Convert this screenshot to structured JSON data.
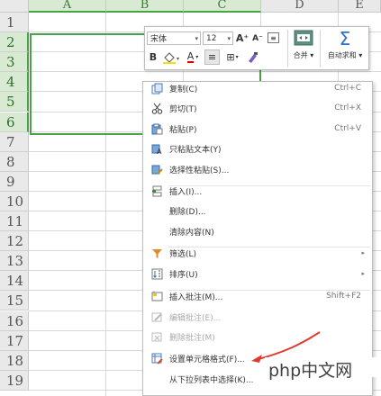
{
  "columns": [
    {
      "label": "A",
      "selected": true
    },
    {
      "label": "B",
      "selected": true
    },
    {
      "label": "C",
      "selected": true
    },
    {
      "label": "D",
      "selected": false
    },
    {
      "label": "E",
      "selected": false
    }
  ],
  "rows": [
    "1",
    "2",
    "3",
    "4",
    "5",
    "6",
    "7",
    "8",
    "9",
    "10",
    "11",
    "12",
    "13",
    "14",
    "15",
    "16",
    "17",
    "18",
    "19"
  ],
  "selected_rows": [
    "2",
    "3",
    "4",
    "5",
    "6"
  ],
  "colors": {
    "selection": "#4aa14a",
    "header_selected": "#d9ead3",
    "arrow": "#e03a2f"
  },
  "toolbar": {
    "font_name": "宋体",
    "font_size": "12",
    "grow_font_icon": "A⁺",
    "shrink_font_icon": "A⁻",
    "bold": "B",
    "underline_color_icon": "A",
    "merge_label": "合并",
    "autosum_label": "自动求和",
    "autosum_icon": "Σ"
  },
  "menu": {
    "items": [
      {
        "icon": "copy-icon",
        "label": "复制(C)",
        "shortcut": "Ctrl+C",
        "disabled": false
      },
      {
        "icon": "scissors-icon",
        "label": "剪切(T)",
        "shortcut": "Ctrl+X",
        "disabled": false
      },
      {
        "icon": "paste-icon",
        "label": "粘贴(P)",
        "shortcut": "Ctrl+V",
        "disabled": false
      },
      {
        "icon": "paste-text-icon",
        "label": "只粘贴文本(Y)",
        "shortcut": "",
        "disabled": false
      },
      {
        "icon": "paste-special-icon",
        "label": "选择性粘贴(S)...",
        "shortcut": "",
        "disabled": false
      },
      {
        "icon": "insert-icon",
        "label": "插入(I)...",
        "shortcut": "",
        "disabled": false
      },
      {
        "icon": "",
        "label": "删除(D)...",
        "shortcut": "",
        "disabled": false
      },
      {
        "icon": "",
        "label": "清除内容(N)",
        "shortcut": "",
        "disabled": false
      },
      {
        "icon": "filter-icon",
        "label": "筛选(L)",
        "shortcut": "",
        "disabled": false,
        "submenu": true
      },
      {
        "icon": "sort-icon",
        "label": "排序(U)",
        "shortcut": "",
        "disabled": false,
        "submenu": true
      },
      {
        "icon": "comment-icon",
        "label": "插入批注(M)...",
        "shortcut": "Shift+F2",
        "disabled": false
      },
      {
        "icon": "edit-comment-icon",
        "label": "编辑批注(E)...",
        "shortcut": "",
        "disabled": true
      },
      {
        "icon": "delete-comment-icon",
        "label": "删除批注(M)",
        "shortcut": "",
        "disabled": true
      },
      {
        "icon": "format-cells-icon",
        "label": "设置单元格格式(F)...",
        "shortcut": "",
        "disabled": false
      },
      {
        "icon": "",
        "label": "从下拉列表中选择(K)...",
        "shortcut": "",
        "disabled": false
      }
    ]
  },
  "watermark": "php中文网"
}
